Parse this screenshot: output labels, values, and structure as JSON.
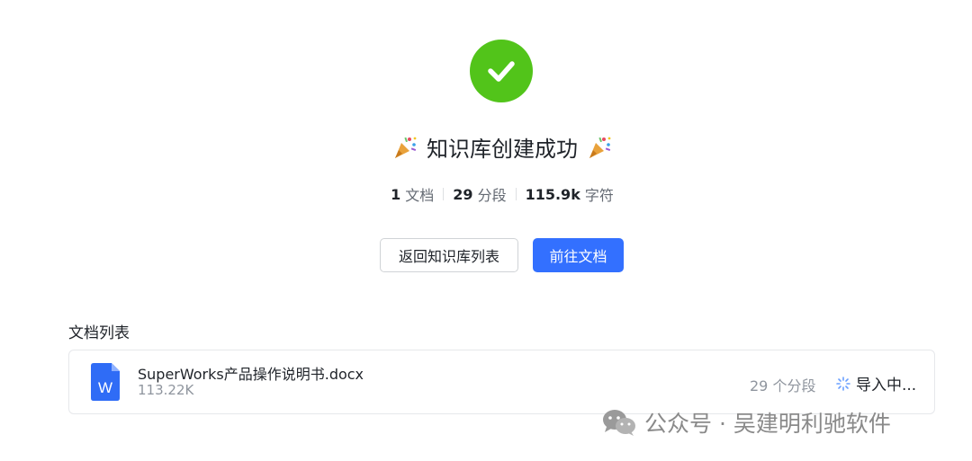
{
  "result": {
    "title": "知识库创建成功",
    "stats": [
      {
        "value": "1",
        "unit": "文档"
      },
      {
        "value": "29",
        "unit": "分段"
      },
      {
        "value": "115.9k",
        "unit": "字符"
      }
    ]
  },
  "actions": {
    "back_label": "返回知识库列表",
    "go_label": "前往文档"
  },
  "doc_list": {
    "title": "文档列表",
    "items": [
      {
        "icon_letter": "W",
        "name": "SuperWorks产品操作说明书.docx",
        "size": "113.22K",
        "segments": "29 个分段",
        "status": "导入中..."
      }
    ]
  },
  "watermark": {
    "text": "公众号 · 吴建明利驰软件"
  },
  "icons": {
    "success": "check-icon",
    "party": "party-popper-icon",
    "doc": "word-doc-icon",
    "loading": "loading-spinner-icon",
    "wechat": "wechat-icon"
  },
  "colors": {
    "success": "#52c41a",
    "primary": "#3370ff",
    "word": "#2f6cf6",
    "spinner": "#6aa0ff"
  }
}
